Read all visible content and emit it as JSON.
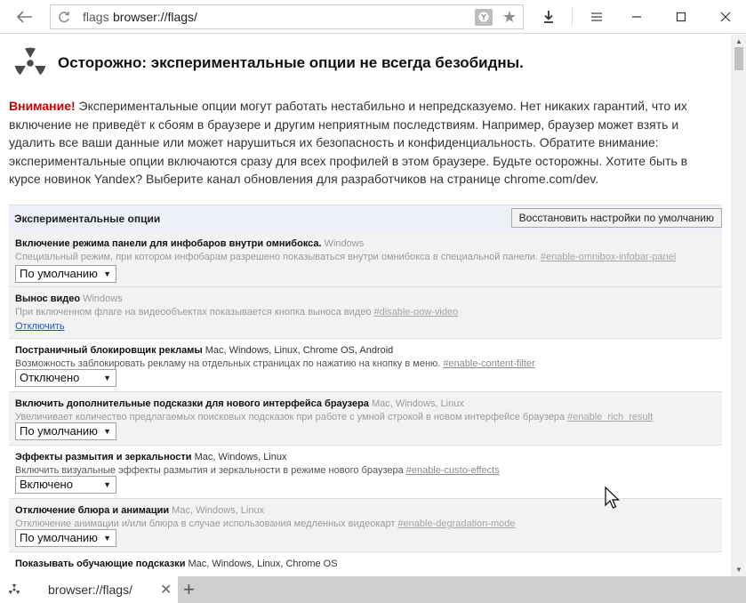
{
  "toolbar": {
    "back_icon": "arrow-left-icon",
    "reload_icon": "reload-icon",
    "url_host": "flags",
    "url_path": "browser://flags/",
    "download_icon": "download-icon",
    "menu_icon": "hamburger-icon"
  },
  "page": {
    "warning_title": "Осторожно: экспериментальные опции не всегда безобидны.",
    "warning_label": "Внимание!",
    "warning_text": " Экспериментальные опции могут работать нестабильно и непредсказуемо. Нет никаких гарантий, что их включение не приведёт к сбоям в браузере и другим неприятным последствиям. Например, браузер может взять и удалить все ваши данные или может нарушиться их безопасность и конфиденциальность. Обратите внимание: экспериментальные опции включаются сразу для всех профилей в этом браузере. Будьте осторожны. Хотите быть в курсе новинок Yandex? Выберите канал обновления для разработчиков на странице chrome.com/dev.",
    "section_title": "Экспериментальные опции",
    "restore_button": "Восстановить настройки по умолчанию",
    "experiments": [
      {
        "title": "Включение режима панели для инфобаров внутри омнибокса.",
        "platforms": "Windows",
        "description": "Специальный режим, при котором инфобарам разрешено показываться внутри омнибокса в специальной панели.",
        "anchor": "#enable-omnibox-infobar-panel",
        "control": "select",
        "value": "По умолчанию",
        "disabled": true
      },
      {
        "title": "Вынос видео",
        "platforms": "Windows",
        "description": "При включенном флаге на видеообъектах показывается кнопка выноса видео",
        "anchor": "#disable-oow-video",
        "control": "link",
        "value": "Отключить",
        "disabled": true
      },
      {
        "title": "Постраничный блокировщик рекламы",
        "platforms": "Mac, Windows, Linux, Chrome OS, Android",
        "description": "Возможность заблокировать рекламу на отдельных страницах по нажатию на кнопку в меню.",
        "anchor": "#enable-content-filter",
        "control": "select",
        "value": "Отключено",
        "disabled": false
      },
      {
        "title": "Включить дополнительные подсказки для нового интерфейса браузера",
        "platforms": "Mac, Windows, Linux",
        "description": "Увеличивает количество предлагаемых поисковых подсказок при работе с умной строкой в новом интерфейсе браузера",
        "anchor": "#enable_rich_result",
        "control": "select",
        "value": "По умолчанию",
        "disabled": true
      },
      {
        "title": "Эффекты размытия и зеркальности",
        "platforms": "Mac, Windows, Linux",
        "description": "Включить визуальные эффекты размытия и зеркальности в режиме нового браузера",
        "anchor": "#enable-custo-effects",
        "control": "select",
        "value": "Включено",
        "disabled": false
      },
      {
        "title": "Отключение блюра и анимации",
        "platforms": "Mac, Windows, Linux",
        "description": "Отключение анимации и/или блюра в случае использования медленных видеокарт",
        "anchor": "#enable-degradation-mode",
        "control": "select",
        "value": "По умолчанию",
        "disabled": true
      },
      {
        "title": "Показывать обучающие подсказки",
        "platforms": "Mac, Windows, Linux, Chrome OS",
        "description": "",
        "anchor": "",
        "control": "none",
        "value": "",
        "disabled": false
      }
    ]
  },
  "tab": {
    "title": "browser://flags/",
    "close_icon": "close-icon",
    "new_tab_icon": "plus-icon"
  },
  "colors": {
    "warning_red": "#cc0000",
    "section_bg": "#eef0f7",
    "link_blue": "#2255cc",
    "disabled_bg": "#f2f2f2"
  }
}
